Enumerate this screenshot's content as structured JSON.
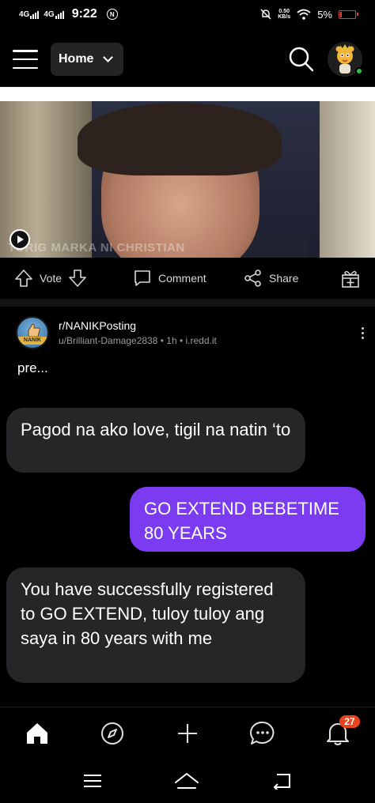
{
  "status_bar": {
    "network_1": "4G",
    "network_2": "4G",
    "time": "9:22",
    "notif_badge": "N",
    "speed_value": "0.50",
    "speed_unit": "KB/s",
    "battery": "5%"
  },
  "top_nav": {
    "feed_label": "Home"
  },
  "video_post": {
    "caption": "TORIG MARKA NI CHRISTIAN",
    "vote_label": "Vote",
    "comment_label": "Comment",
    "share_label": "Share"
  },
  "post": {
    "subreddit": "r/NANIKPosting",
    "icon_text": "NANIK",
    "byline": "u/Brilliant-Damage2838 • 1h • i.redd.it",
    "title": "pre...",
    "messages": [
      {
        "sender": "them",
        "text": "Pagod na ako love, tigil na natin ‘to"
      },
      {
        "sender": "me",
        "text": "GO EXTEND BEBETIME 80 YEARS"
      },
      {
        "sender": "them",
        "text": "You have successfully registered to GO EXTEND, tuloy tuloy ang saya in 80 years with me"
      }
    ]
  },
  "bottom_nav": {
    "items": [
      "home-icon",
      "compass-icon",
      "plus-icon",
      "chat-icon",
      "bell-icon"
    ],
    "inbox_badge": "27"
  },
  "colors": {
    "accent": "#7b3cf1",
    "badge": "#e8451e",
    "bubble_gray": "#262629",
    "online": "#2fbf4a"
  }
}
